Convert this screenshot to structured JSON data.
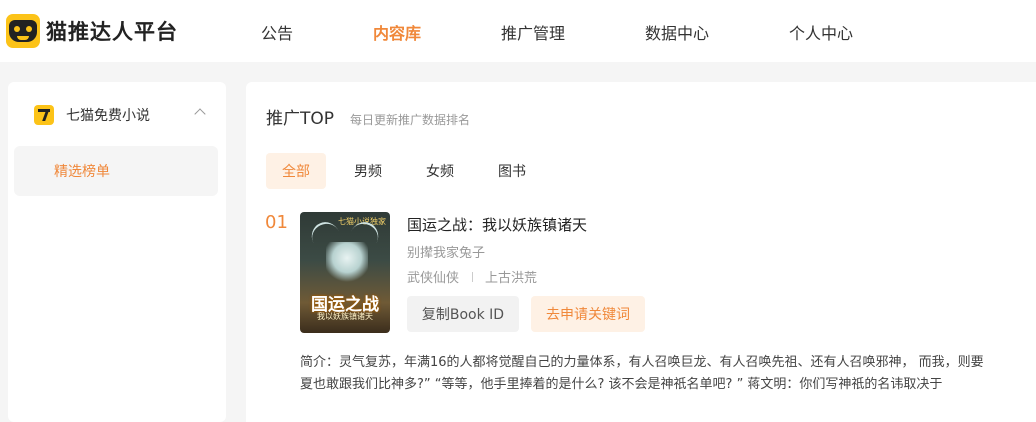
{
  "header": {
    "brand": "猫推达人平台",
    "nav": [
      {
        "label": "公告",
        "active": false
      },
      {
        "label": "内容库",
        "active": true
      },
      {
        "label": "推广管理",
        "active": false
      },
      {
        "label": "数据中心",
        "active": false
      },
      {
        "label": "个人中心",
        "active": false
      }
    ]
  },
  "sidebar": {
    "group_label": "七猫免费小说",
    "group_icon": "qimao-icon",
    "expanded": true,
    "sub_item": "精选榜单"
  },
  "main": {
    "title": "推广TOP",
    "subtitle": "每日更新推广数据排名",
    "tabs": [
      {
        "label": "全部",
        "active": true
      },
      {
        "label": "男频",
        "active": false
      },
      {
        "label": "女频",
        "active": false
      },
      {
        "label": "图书",
        "active": false
      }
    ],
    "items": [
      {
        "rank": "01",
        "cover_badge": "七猫小说独家",
        "cover_title": "国运之战",
        "cover_subtitle": "我以妖族镇诸天",
        "title": "国运之战：我以妖族镇诸天",
        "author": "别撵我家兔子",
        "tags": [
          "武侠仙侠",
          "上古洪荒"
        ],
        "copy_button": "复制Book ID",
        "apply_button": "去申请关键词",
        "intro_line1": "简介：灵气复苏，年满16的人都将觉醒自己的力量体系，有人召唤巨龙、有人召唤先祖、还有人召唤邪神， 而我，则要",
        "intro_line2": "夏也敢跟我们比神多?” “等等，他手里捧着的是什么? 该不会是神祇名单吧? ” 蒋文明：你们写神祇的名讳取决于"
      }
    ]
  },
  "colors": {
    "accent": "#f0883a",
    "accent_bg": "#fef1e5",
    "brand_yellow": "#fcc318"
  }
}
